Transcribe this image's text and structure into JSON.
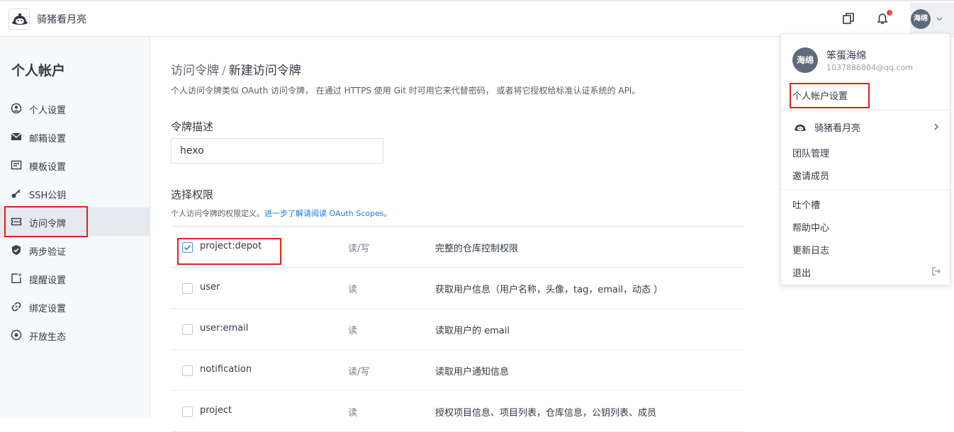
{
  "header": {
    "team_name": "骑猪看月亮",
    "avatar_text": "海绵"
  },
  "sidebar": {
    "title": "个人帐户",
    "items": [
      {
        "label": "个人设置",
        "icon": "user-circle-icon"
      },
      {
        "label": "邮箱设置",
        "icon": "envelope-icon"
      },
      {
        "label": "模板设置",
        "icon": "template-icon"
      },
      {
        "label": "SSH公钥",
        "icon": "key-icon"
      },
      {
        "label": "访问令牌",
        "icon": "ticket-icon",
        "active": true
      },
      {
        "label": "两步验证",
        "icon": "shield-icon"
      },
      {
        "label": "提醒设置",
        "icon": "reminder-icon"
      },
      {
        "label": "绑定设置",
        "icon": "link-icon"
      },
      {
        "label": "开放生态",
        "icon": "ecosystem-icon"
      }
    ]
  },
  "main": {
    "breadcrumb_parent": "访问令牌",
    "breadcrumb_sep": "/",
    "breadcrumb_current": "新建访问令牌",
    "intro": "个人访问令牌类似 OAuth 访问令牌， 在通过 HTTPS 使用 Git 时可用它来代替密码， 或者将它授权给标准认证系统的 API。",
    "desc_label": "令牌描述",
    "desc_value": "hexo",
    "perm_label": "选择权限",
    "perm_intro": "个人访问令牌的权限定义。",
    "perm_link": "进一步了解请阅读 OAuth Scopes。",
    "permissions": [
      {
        "name": "project:depot",
        "access": "读/写",
        "desc": "完整的仓库控制权限",
        "checked": true
      },
      {
        "name": "user",
        "access": "读",
        "desc": "获取用户信息（用户名称，头像，tag，email，动态 ）",
        "checked": false
      },
      {
        "name": "user:email",
        "access": "读",
        "desc": "读取用户的 email",
        "checked": false
      },
      {
        "name": "notification",
        "access": "读/写",
        "desc": "读取用户通知信息",
        "checked": false
      },
      {
        "name": "project",
        "access": "读",
        "desc": "授权项目信息、项目列表，仓库信息，公钥列表、成员",
        "checked": false
      }
    ]
  },
  "dropdown": {
    "avatar_text": "海绵",
    "user_name": "笨蛋海绵",
    "email": "1037886804@qq.com",
    "account_settings": "个人帐户设置",
    "team_name": "骑猪看月亮",
    "team_manage": "团队管理",
    "invite": "邀请成员",
    "feedback": "吐个槽",
    "help": "帮助中心",
    "changelog": "更新日志",
    "logout": "退出"
  },
  "colors": {
    "accent": "#1f7ae0",
    "highlight_box": "#d9251d",
    "notify_dot": "#f0483e",
    "sidebar_bg": "#f7f8fa"
  }
}
